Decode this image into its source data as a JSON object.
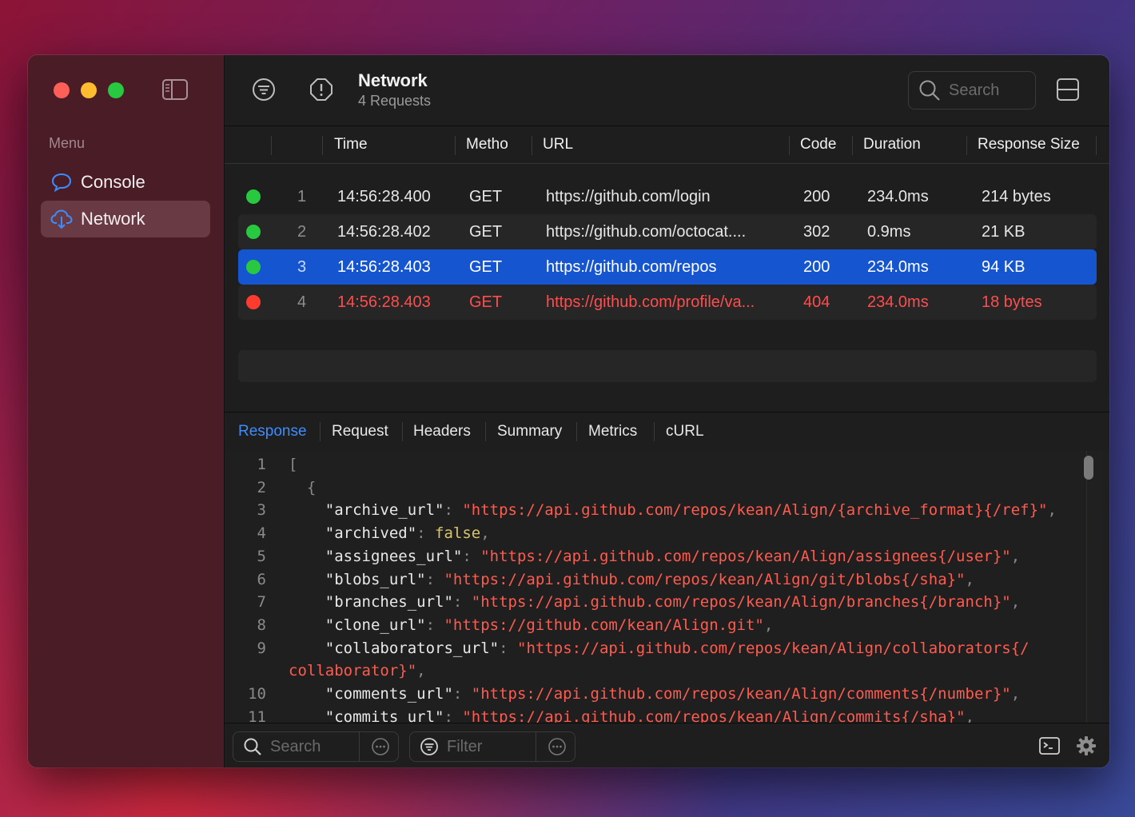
{
  "sidebar": {
    "menu_label": "Menu",
    "items": [
      {
        "label": "Console",
        "icon": "chat-bubble-icon"
      },
      {
        "label": "Network",
        "icon": "cloud-download-icon"
      }
    ]
  },
  "toolbar": {
    "title": "Network",
    "subtitle": "4 Requests",
    "search_placeholder": "Search"
  },
  "table": {
    "columns": [
      "Time",
      "Metho",
      "URL",
      "Code",
      "Duration",
      "Response Size"
    ],
    "rows": [
      {
        "status": "success",
        "index": "1",
        "time": "14:56:28.400",
        "method": "GET",
        "url": "https://github.com/login",
        "code": "200",
        "duration": "234.0ms",
        "size": "214 bytes"
      },
      {
        "status": "success",
        "index": "2",
        "time": "14:56:28.402",
        "method": "GET",
        "url": "https://github.com/octocat....",
        "code": "302",
        "duration": "0.9ms",
        "size": "21 KB"
      },
      {
        "status": "success",
        "index": "3",
        "time": "14:56:28.403",
        "method": "GET",
        "url": "https://github.com/repos",
        "code": "200",
        "duration": "234.0ms",
        "size": "94 KB"
      },
      {
        "status": "error",
        "index": "4",
        "time": "14:56:28.403",
        "method": "GET",
        "url": "https://github.com/profile/va...",
        "code": "404",
        "duration": "234.0ms",
        "size": "18 bytes"
      }
    ]
  },
  "tabs": [
    "Response",
    "Request",
    "Headers",
    "Summary",
    "Metrics",
    "cURL"
  ],
  "active_tab": "Response",
  "code_lines": [
    {
      "n": "1",
      "indent": "",
      "key": "",
      "value": "",
      "type": "open",
      "text": "["
    },
    {
      "n": "2",
      "indent": "  ",
      "key": "",
      "value": "",
      "type": "open",
      "text": "{"
    },
    {
      "n": "3",
      "indent": "    ",
      "key": "\"archive_url\"",
      "value": "\"https://api.github.com/repos/kean/Align/{archive_format}{/ref}\"",
      "type": "str"
    },
    {
      "n": "4",
      "indent": "    ",
      "key": "\"archived\"",
      "value": "false",
      "type": "bool"
    },
    {
      "n": "5",
      "indent": "    ",
      "key": "\"assignees_url\"",
      "value": "\"https://api.github.com/repos/kean/Align/assignees{/user}\"",
      "type": "str"
    },
    {
      "n": "6",
      "indent": "    ",
      "key": "\"blobs_url\"",
      "value": "\"https://api.github.com/repos/kean/Align/git/blobs{/sha}\"",
      "type": "str"
    },
    {
      "n": "7",
      "indent": "    ",
      "key": "\"branches_url\"",
      "value": "\"https://api.github.com/repos/kean/Align/branches{/branch}\"",
      "type": "str"
    },
    {
      "n": "8",
      "indent": "    ",
      "key": "\"clone_url\"",
      "value": "\"https://github.com/kean/Align.git\"",
      "type": "str"
    },
    {
      "n": "9",
      "indent": "    ",
      "key": "\"collaborators_url\"",
      "value": "\"https://api.github.com/repos/kean/Align/collaborators{/",
      "type": "str-open"
    },
    {
      "n": "",
      "indent": "",
      "key": "",
      "value": "collaborator}\"",
      "type": "str-cont"
    },
    {
      "n": "10",
      "indent": "    ",
      "key": "\"comments_url\"",
      "value": "\"https://api.github.com/repos/kean/Align/comments{/number}\"",
      "type": "str"
    },
    {
      "n": "11",
      "indent": "    ",
      "key": "\"commits_url\"",
      "value": "\"https://api.github.com/repos/kean/Align/commits{/sha}\"",
      "type": "str"
    }
  ],
  "bottom": {
    "search_placeholder": "Search",
    "filter_placeholder": "Filter"
  },
  "colors": {
    "accent": "#1556d0",
    "success": "#28c840",
    "error": "#ff3b30",
    "string": "#ff5b4f",
    "bool": "#d8c46a"
  }
}
